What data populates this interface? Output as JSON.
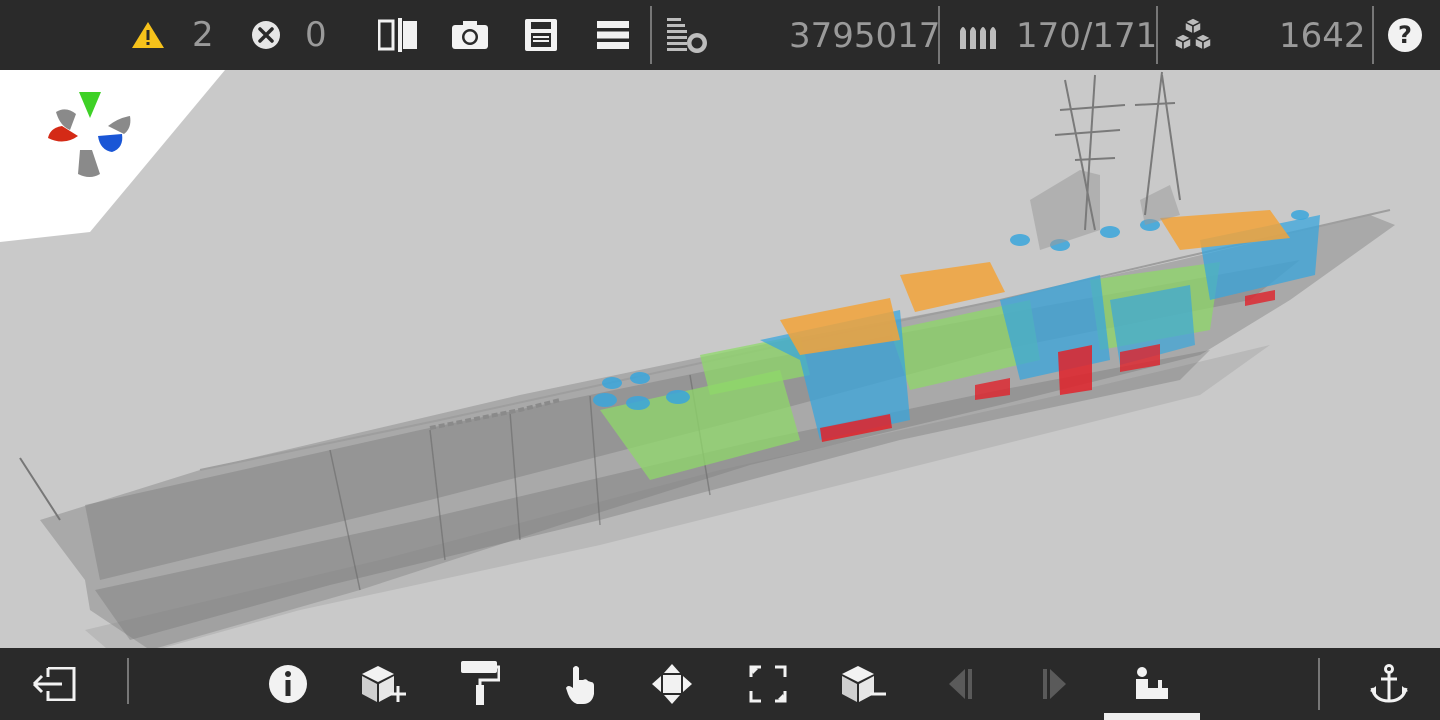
{
  "status": {
    "warnings_count": "2",
    "errors_count": "0",
    "cost": "3795017",
    "ammo": "170/171",
    "parts_count": "1642"
  },
  "icons": {
    "warning": "warning-triangle-icon",
    "error": "error-x-icon",
    "compare": "compare-panels-icon",
    "camera": "camera-icon",
    "save": "save-disk-icon",
    "menu": "hamburger-menu-icon",
    "stats": "stats-list-icon",
    "ammo": "ammo-shells-icon",
    "parts": "stacked-cubes-icon",
    "help": "help-question-icon",
    "exit": "exit-icon",
    "info": "info-icon",
    "add_part": "add-block-icon",
    "paint": "paint-roller-icon",
    "select": "hand-pointer-icon",
    "move": "move-arrows-icon",
    "resize": "resize-frame-icon",
    "remove_part": "remove-block-icon",
    "prev": "previous-icon",
    "next": "next-icon",
    "crew": "crew-stations-icon",
    "anchor": "anchor-icon"
  },
  "colors": {
    "bar_bg": "#2a2a2a",
    "text_gray": "#9a9a9a",
    "icon_white": "#f2f2f2",
    "warning_yellow": "#f6c21b",
    "module_orange": "#f2a33a",
    "module_blue": "#3aa6dc",
    "module_green": "#8fd86a",
    "module_red": "#e0222a",
    "hull_gray": "#8e8e8e"
  }
}
